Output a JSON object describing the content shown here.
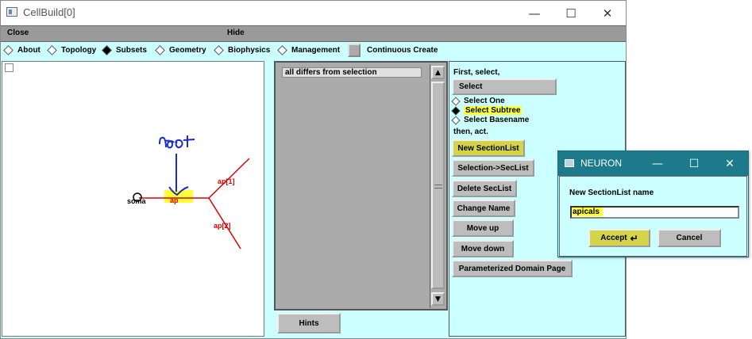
{
  "main_window": {
    "title": "CellBuild[0]",
    "controls": {
      "minimize": "—",
      "maximize": "☐",
      "close": "✕"
    }
  },
  "menubar": {
    "close": "Close",
    "hide": "Hide"
  },
  "tabs": [
    {
      "label": "About",
      "selected": false
    },
    {
      "label": "Topology",
      "selected": false
    },
    {
      "label": "Subsets",
      "selected": true
    },
    {
      "label": "Geometry",
      "selected": false
    },
    {
      "label": "Biophysics",
      "selected": false
    },
    {
      "label": "Management",
      "selected": false
    }
  ],
  "continuous_create": "Continuous Create",
  "canvas": {
    "labels": {
      "soma": "soma",
      "ap": "ap",
      "ap1": "ap[1]",
      "ap2": "ap[2]"
    },
    "annotation": "root",
    "colors": {
      "section": "#dd0000",
      "highlight": "#ffff33",
      "annotation": "#1a2bd6"
    }
  },
  "list": {
    "items": [
      "all differs from selection"
    ]
  },
  "hints_button": "Hints",
  "right_panel": {
    "first_select": "First, select,",
    "select_button": "Select",
    "options": [
      {
        "label": "Select One",
        "selected": false
      },
      {
        "label": "Select Subtree",
        "selected": true
      },
      {
        "label": "Select Basename",
        "selected": false
      }
    ],
    "then_act": "then, act.",
    "actions": {
      "new_sectionlist": "New SectionList",
      "selection_to_seclist": "Selection->SecList",
      "delete_seclist": "Delete SecList",
      "change_name": "Change Name",
      "move_up": "Move up",
      "move_down": "Move down",
      "param_domain": "Parameterized Domain Page"
    }
  },
  "dialog": {
    "title": "NEURON",
    "prompt": "New SectionList name",
    "input_value": "apicals",
    "accept": "Accept",
    "cancel": "Cancel",
    "controls": {
      "minimize": "—",
      "maximize": "☐",
      "close": "✕"
    }
  },
  "colors": {
    "panel_bg": "#ccffff",
    "button_bg": "#bdbdbd",
    "button_highlight": "#d4d44a",
    "dialog_title_bg": "#1d7a8a"
  }
}
